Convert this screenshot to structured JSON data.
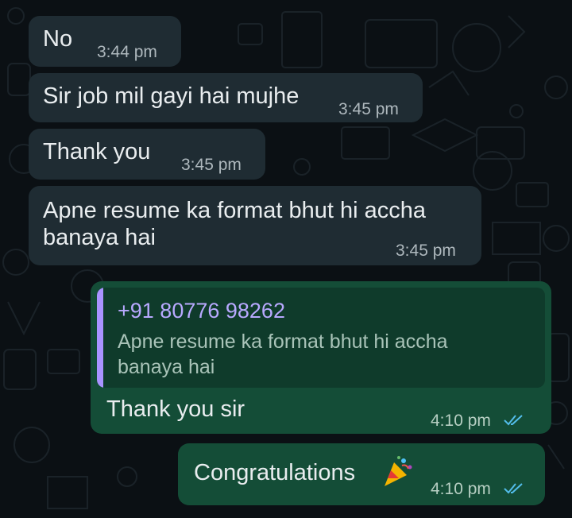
{
  "incoming": [
    {
      "text": "No",
      "time": "3:44 pm"
    },
    {
      "text": "Sir job mil gayi hai mujhe",
      "time": "3:45 pm"
    },
    {
      "text": "Thank you",
      "time": "3:45 pm"
    },
    {
      "text_line1": "Apne resume ka format bhut hi accha",
      "text_line2": "banaya hai",
      "time": "3:45 pm"
    }
  ],
  "outgoing": [
    {
      "reply_sender": "+91 80776 98262",
      "reply_line1": "Apne resume ka format bhut hi accha",
      "reply_line2": "banaya hai",
      "text": "Thank you sir",
      "time": "4:10 pm",
      "status_icon": "double-check-read"
    },
    {
      "text": "Congratulations",
      "emoji_icon": "party-popper",
      "time": "4:10 pm",
      "status_icon": "double-check-read"
    }
  ],
  "colors": {
    "background": "#0b1014",
    "incoming_bubble": "#1f2c33",
    "outgoing_bubble": "#144d37",
    "read_ticks": "#53bdeb",
    "quote_accent": "#a993ff"
  }
}
